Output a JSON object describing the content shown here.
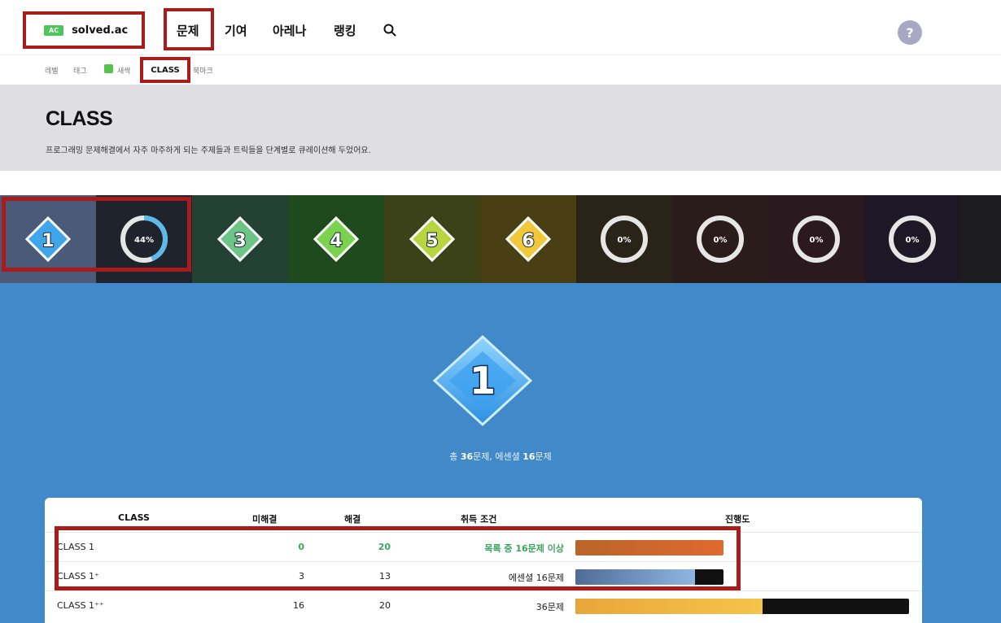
{
  "nav": {
    "logo_badge": "AC",
    "logo_text": "solved.ac",
    "items": [
      "문제",
      "기여",
      "아레나",
      "랭킹"
    ],
    "help_label": "?"
  },
  "subnav": {
    "items": [
      "레벨",
      "태그",
      "새싹",
      "CLASS",
      "북마크"
    ]
  },
  "header": {
    "title": "CLASS",
    "description": "프로그래밍 문제해결에서 자주 마주하게 되는 주제들과 트릭들을 단계별로 큐레이션해 두었어요."
  },
  "strip": {
    "cells": [
      {
        "label": "1",
        "kind": "badge",
        "bg": "#4a5a78",
        "color": "#3fa6ea"
      },
      {
        "label": "44%",
        "kind": "ring",
        "progress": 44,
        "bg": "#1f232b"
      },
      {
        "label": "3",
        "kind": "badge",
        "bg": "#244233",
        "color": "#6cc487"
      },
      {
        "label": "4",
        "kind": "badge",
        "bg": "#1f4a1d",
        "color": "#7bd24f"
      },
      {
        "label": "5",
        "kind": "badge",
        "bg": "#3b4218",
        "color": "#b8d43e"
      },
      {
        "label": "6",
        "kind": "badge",
        "bg": "#4a3f14",
        "color": "#f0c83a"
      },
      {
        "label": "0%",
        "kind": "ring",
        "progress": 0,
        "bg": "#2a2418"
      },
      {
        "label": "0%",
        "kind": "ring",
        "progress": 0,
        "bg": "#2a1c1a"
      },
      {
        "label": "0%",
        "kind": "ring",
        "progress": 0,
        "bg": "#2a1a20"
      },
      {
        "label": "0%",
        "kind": "ring",
        "progress": 0,
        "bg": "#1e1826"
      }
    ]
  },
  "main": {
    "badge_label": "1",
    "summary_prefix": "총 ",
    "summary_total": "36",
    "summary_mid": "문제, 에센셜 ",
    "summary_essential": "16",
    "summary_suffix": "문제"
  },
  "table": {
    "headers": [
      "CLASS",
      "미해결",
      "해결",
      "취득 조건",
      "진행도"
    ],
    "rows": [
      {
        "name": "CLASS 1",
        "unsolved": "0",
        "solved": "20",
        "condition": "목록 중 16문제 이상",
        "progress": 100,
        "highlight": true,
        "fill": "linear-gradient(90deg,#b8652a,#e0692e)"
      },
      {
        "name": "CLASS 1⁺",
        "unsolved": "3",
        "solved": "13",
        "condition": "에센셜 16문제",
        "progress": 81,
        "highlight": false,
        "fill": "linear-gradient(90deg,#4f6c96,#8fb6e2)"
      },
      {
        "name": "CLASS 1⁺⁺",
        "unsolved": "16",
        "solved": "20",
        "condition": "36문제",
        "progress": 56,
        "highlight": false,
        "fill": "linear-gradient(90deg,#e8a63a,#f5c44a)"
      }
    ]
  },
  "colors": {
    "accent_red": "#a81c1c",
    "main_blue": "#4189c9",
    "success_green": "#3aa55e"
  }
}
